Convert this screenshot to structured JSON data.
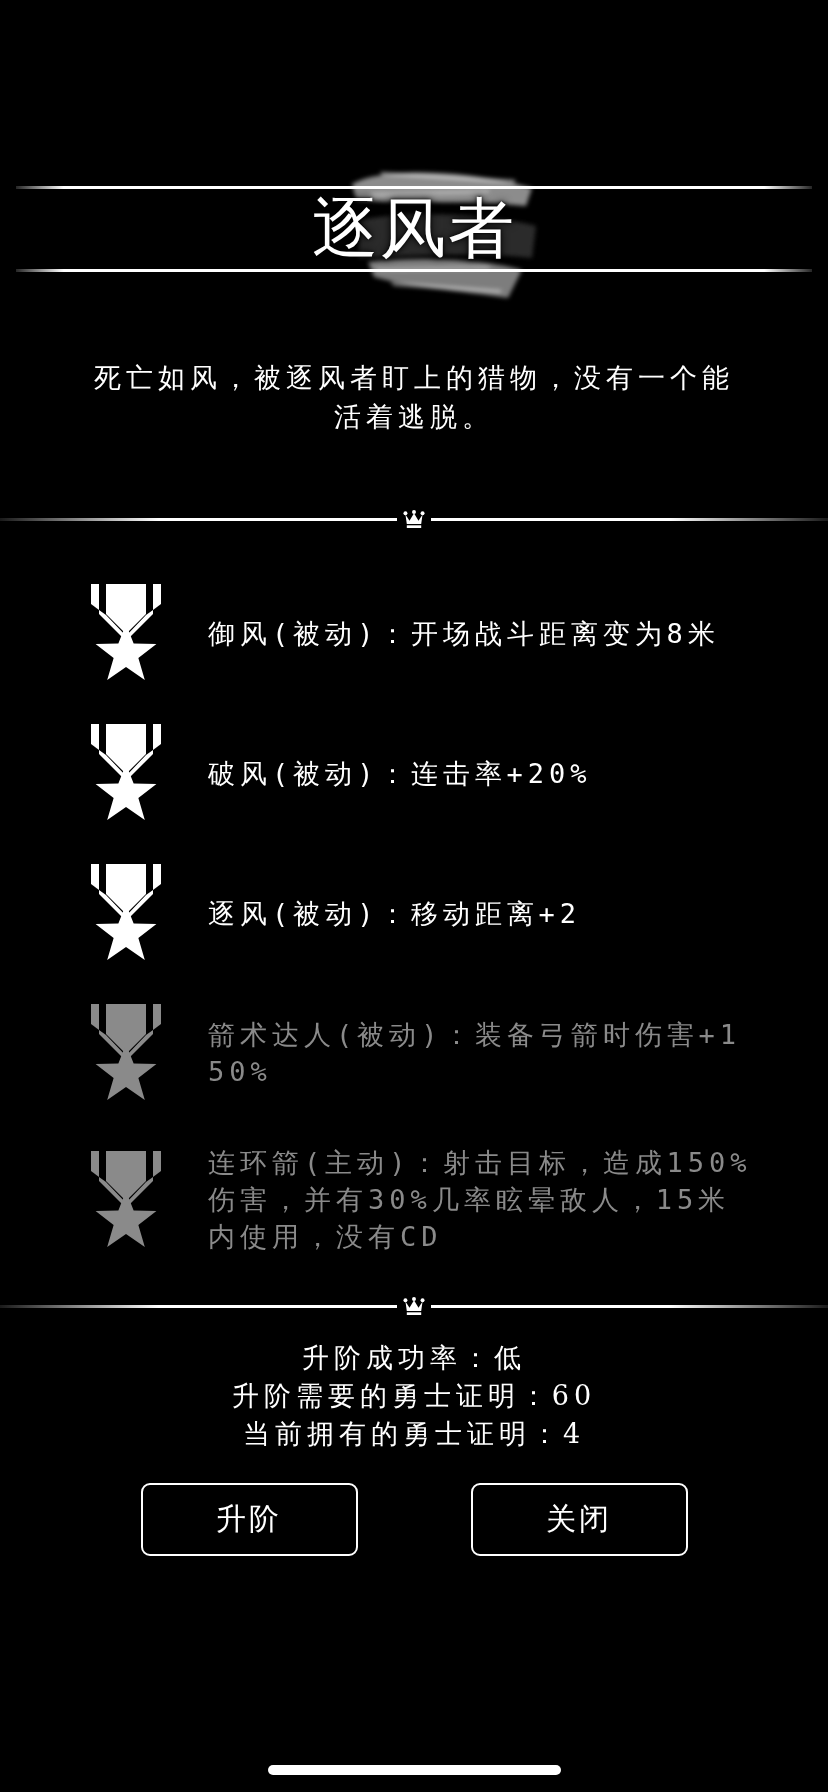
{
  "title": "逐风者",
  "description": "死亡如风，被逐风者盯上的猎物，没有一个能活着逃脱。",
  "skills": [
    {
      "text": "御风(被动)：开场战斗距离变为8米",
      "unlocked": true
    },
    {
      "text": "破风(被动)：连击率+20%",
      "unlocked": true
    },
    {
      "text": "逐风(被动)：移动距离+2",
      "unlocked": true
    },
    {
      "text": "箭术达人(被动)：装备弓箭时伤害+150%",
      "unlocked": false
    },
    {
      "text": "连环箭(主动)：射击目标，造成150%伤害，并有30%几率眩晕敌人，15米内使用，没有CD",
      "unlocked": false
    }
  ],
  "upgrade_info": [
    "升阶成功率：低",
    "升阶需要的勇士证明：60",
    "当前拥有的勇士证明：4"
  ],
  "buttons": [
    "升阶",
    "关闭"
  ]
}
